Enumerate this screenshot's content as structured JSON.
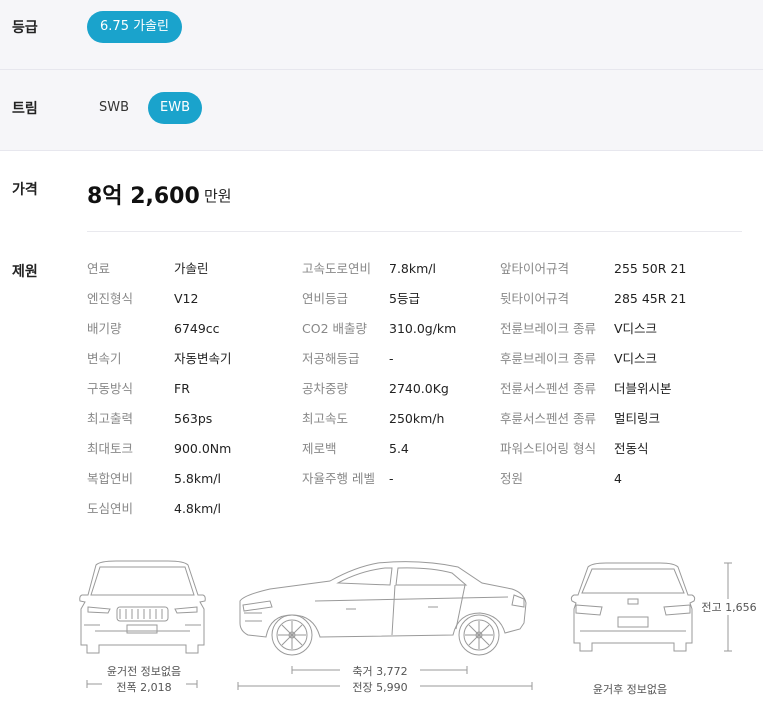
{
  "grade": {
    "label": "등급",
    "options": [
      "6.75 가솔린"
    ],
    "selected": "6.75 가솔린"
  },
  "trim": {
    "label": "트림",
    "options": [
      "SWB",
      "EWB"
    ],
    "selected": "EWB"
  },
  "price": {
    "label": "가격",
    "value": "8억 2,600",
    "unit": "만원"
  },
  "specs": {
    "label": "제원",
    "columns": [
      [
        {
          "k": "연료",
          "v": "가솔린"
        },
        {
          "k": "엔진형식",
          "v": "V12"
        },
        {
          "k": "배기량",
          "v": "6749cc"
        },
        {
          "k": "변속기",
          "v": "자동변속기"
        },
        {
          "k": "구동방식",
          "v": "FR"
        },
        {
          "k": "최고출력",
          "v": "563ps"
        },
        {
          "k": "최대토크",
          "v": "900.0Nm"
        },
        {
          "k": "복합연비",
          "v": "5.8km/l"
        },
        {
          "k": "도심연비",
          "v": "4.8km/l"
        }
      ],
      [
        {
          "k": "고속도로연비",
          "v": "7.8km/l"
        },
        {
          "k": "연비등급",
          "v": "5등급"
        },
        {
          "k": "CO2 배출량",
          "v": "310.0g/km"
        },
        {
          "k": "저공해등급",
          "v": "-"
        },
        {
          "k": "공차중량",
          "v": "2740.0Kg"
        },
        {
          "k": "최고속도",
          "v": "250km/h"
        },
        {
          "k": "제로백",
          "v": "5.4"
        },
        {
          "k": "자율주행 레벨",
          "v": "-"
        }
      ],
      [
        {
          "k": "앞타이어규격",
          "v": "255 50R 21"
        },
        {
          "k": "뒷타이어규격",
          "v": "285 45R 21"
        },
        {
          "k": "전륜브레이크 종류",
          "v": "V디스크"
        },
        {
          "k": "후륜브레이크 종류",
          "v": "V디스크"
        },
        {
          "k": "전륜서스펜션 종류",
          "v": "더블위시본"
        },
        {
          "k": "후륜서스펜션 종류",
          "v": "멀티링크"
        },
        {
          "k": "파워스티어링 형식",
          "v": "전동식"
        },
        {
          "k": "정원",
          "v": "4"
        }
      ]
    ]
  },
  "dimensions": {
    "front_tread": "윤거전 정보없음",
    "width": "전폭 2,018",
    "wheelbase": "축거 3,772",
    "length": "전장 5,990",
    "rear_tread": "윤거후 정보없음",
    "height": "전고 1,656"
  }
}
